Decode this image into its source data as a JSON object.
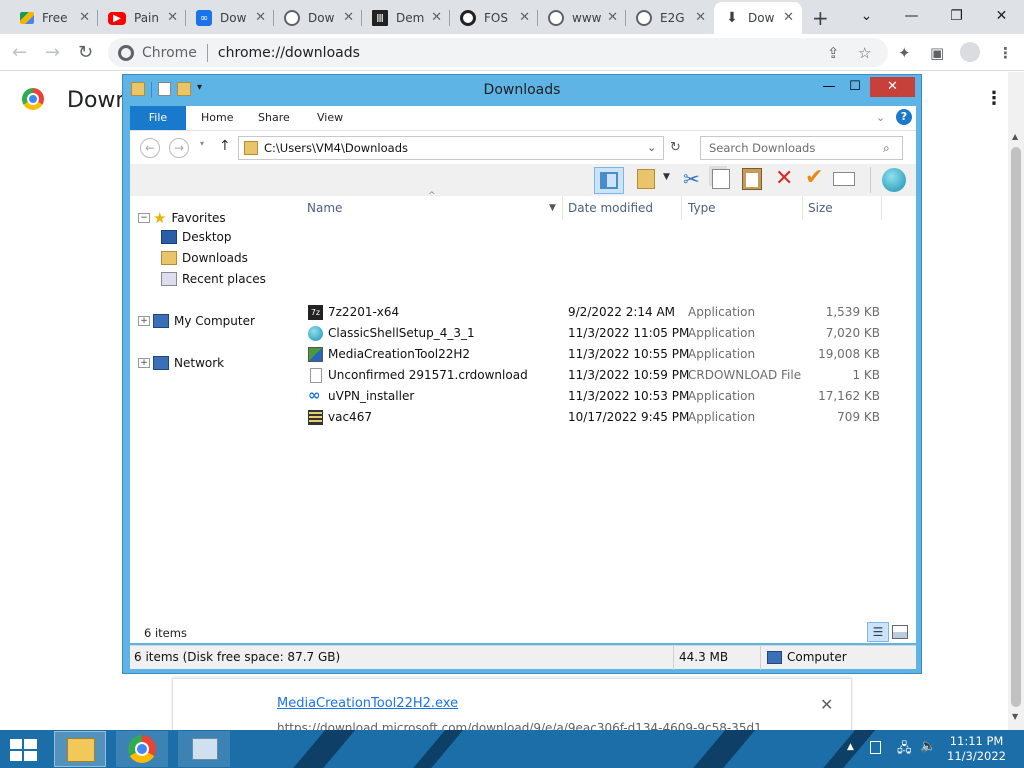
{
  "tabs": [
    {
      "label": "Free",
      "icon": "drive-favicon",
      "color": "#f4b400"
    },
    {
      "label": "Pain",
      "icon": "youtube-favicon",
      "color": "#ff0000"
    },
    {
      "label": "Dow",
      "icon": "uvpn-favicon",
      "color": "#1a73e8"
    },
    {
      "label": "Dow",
      "icon": "globe-favicon",
      "color": "#5f6368"
    },
    {
      "label": "Dem",
      "icon": "bank-favicon",
      "color": "#222222"
    },
    {
      "label": "FOS",
      "icon": "ring-favicon",
      "color": "#222222"
    },
    {
      "label": "www",
      "icon": "globe-favicon",
      "color": "#5f6368"
    },
    {
      "label": "E2G",
      "icon": "globe-favicon",
      "color": "#5f6368"
    },
    {
      "label": "Dow",
      "icon": "download-favicon",
      "color": "#3c4043"
    }
  ],
  "omnibox": {
    "chip": "Chrome",
    "url": "chrome://downloads"
  },
  "page": {
    "title": "Down"
  },
  "explorer": {
    "title": "Downloads",
    "ribbon": {
      "file": "File",
      "home": "Home",
      "share": "Share",
      "view": "View"
    },
    "address": "C:\\Users\\VM4\\Downloads",
    "search_placeholder": "Search Downloads",
    "nav": {
      "favorites": "Favorites",
      "desktop": "Desktop",
      "downloads": "Downloads",
      "recent": "Recent places",
      "computer": "My Computer",
      "network": "Network"
    },
    "columns": {
      "name": "Name",
      "date": "Date modified",
      "type": "Type",
      "size": "Size"
    },
    "files": [
      {
        "name": "7z2201-x64",
        "date": "9/2/2022 2:14 AM",
        "type": "Application",
        "size": "1,539 KB",
        "icon": "7zip-icon"
      },
      {
        "name": "ClassicShellSetup_4_3_1",
        "date": "11/3/2022 11:05 PM",
        "type": "Application",
        "size": "7,020 KB",
        "icon": "shell-icon"
      },
      {
        "name": "MediaCreationTool22H2",
        "date": "11/3/2022 10:55 PM",
        "type": "Application",
        "size": "19,008 KB",
        "icon": "media-tool-icon"
      },
      {
        "name": "Unconfirmed 291571.crdownload",
        "date": "11/3/2022 10:59 PM",
        "type": "CRDOWNLOAD File",
        "size": "1 KB",
        "icon": "blank-file-icon"
      },
      {
        "name": "uVPN_installer",
        "date": "11/3/2022 10:53 PM",
        "type": "Application",
        "size": "17,162 KB",
        "icon": "uvpn-icon"
      },
      {
        "name": "vac467",
        "date": "10/17/2022 9:45 PM",
        "type": "Application",
        "size": "709 KB",
        "icon": "installer-icon"
      }
    ],
    "item_count": "6 items",
    "status": {
      "left": "6 items (Disk free space: 87.7 GB)",
      "size": "44.3 MB",
      "location": "Computer"
    }
  },
  "shelf": {
    "filename": "MediaCreationTool22H2.exe",
    "url": "https://download.microsoft.com/download/9/e/a/9eac306f-d134-4609-9c58-35d1"
  },
  "clock": {
    "time": "11:11 PM",
    "date": "11/3/2022"
  }
}
